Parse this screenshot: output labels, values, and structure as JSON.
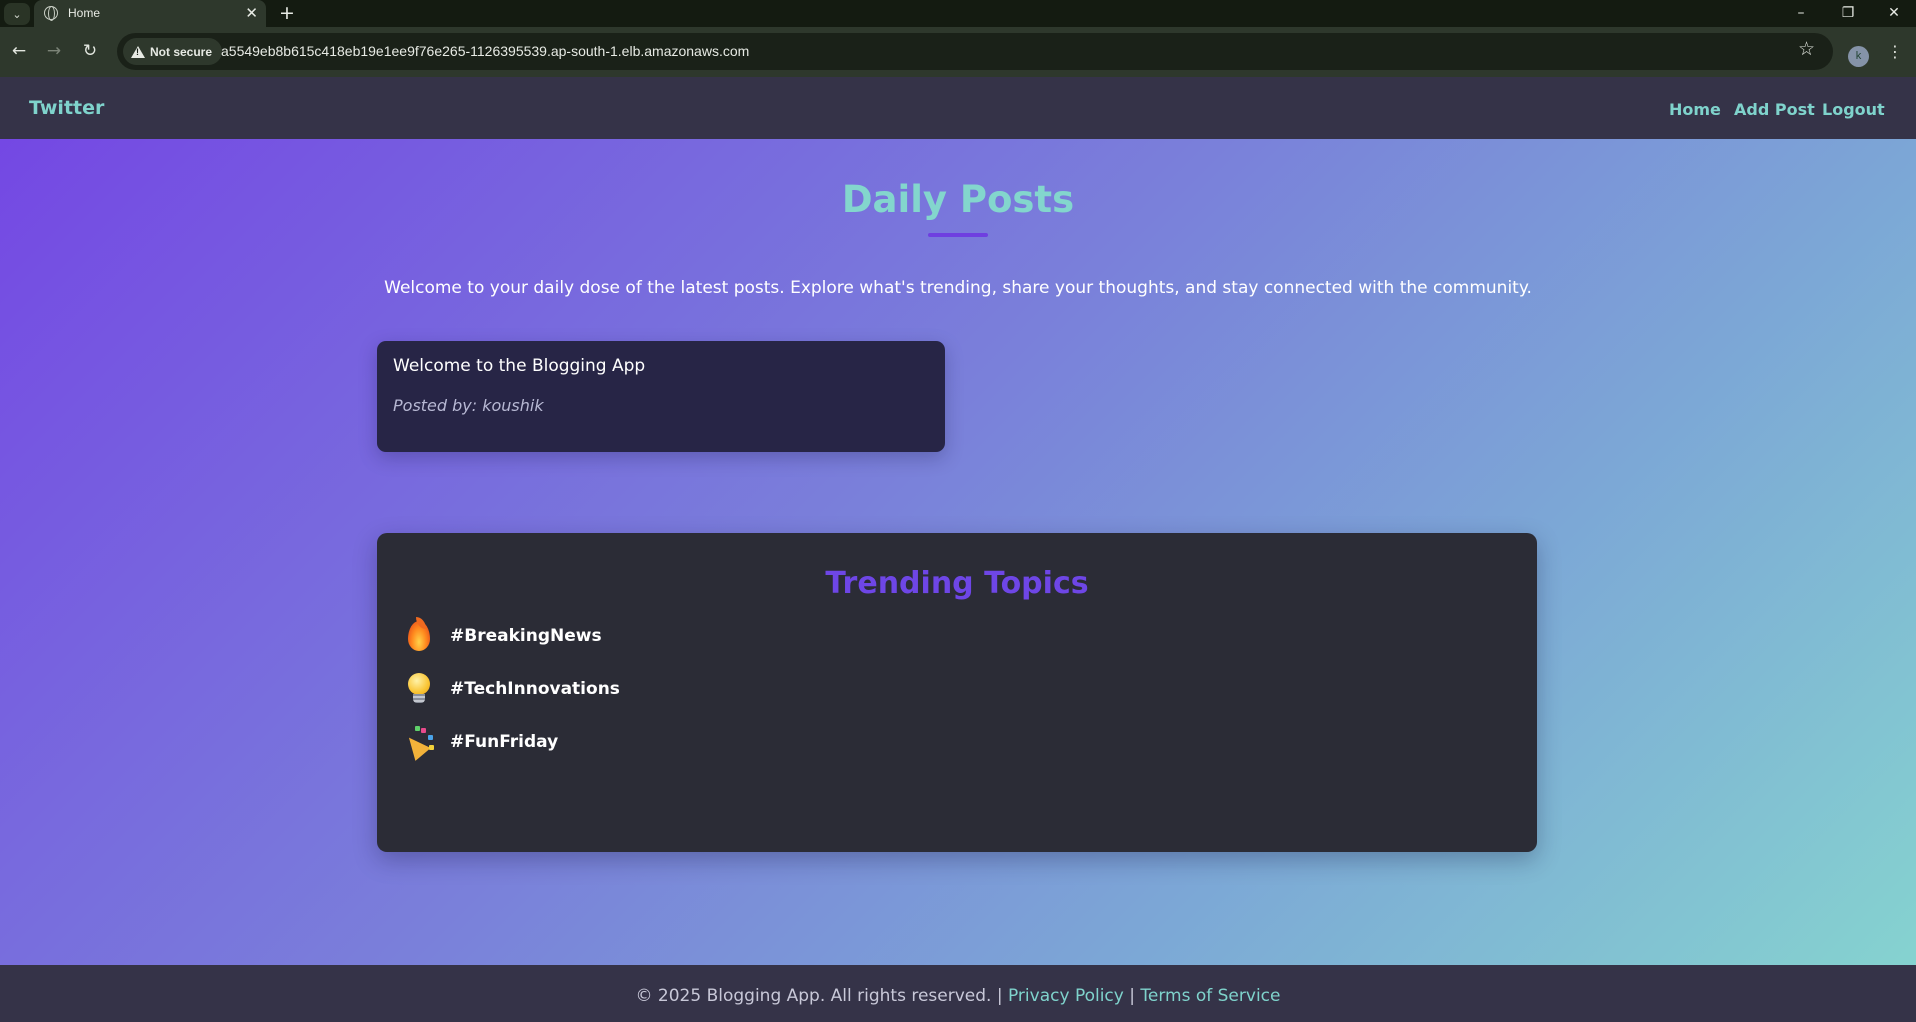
{
  "browser": {
    "tab_title": "Home",
    "new_tab_symbol": "+",
    "security_label": "Not secure",
    "url": "a5549eb8b615c418eb19e1ee9f76e265-1126395539.ap-south-1.elb.amazonaws.com",
    "profile_initial": "k"
  },
  "header": {
    "brand": "Twitter",
    "nav": [
      {
        "label": "Home"
      },
      {
        "label": "Add Post"
      },
      {
        "label": "Logout"
      }
    ]
  },
  "main": {
    "title": "Daily Posts",
    "intro": "Welcome to your daily dose of the latest posts. Explore what's trending, share your thoughts, and stay connected with the community.",
    "posts": [
      {
        "title": "Welcome to the Blogging App",
        "author_line": "Posted by: koushik"
      }
    ]
  },
  "trending": {
    "title": "Trending Topics",
    "topics": [
      {
        "icon": "fire-icon",
        "label": "#BreakingNews"
      },
      {
        "icon": "lightbulb-icon",
        "label": "#TechInnovations"
      },
      {
        "icon": "party-popper-icon",
        "label": "#FunFriday"
      }
    ]
  },
  "footer": {
    "copyright": "© 2025 Blogging App. All rights reserved.",
    "separator": "|",
    "privacy_label": "Privacy Policy",
    "terms_label": "Terms of Service"
  },
  "colors": {
    "accent_teal": "#7fd3cc",
    "accent_purple": "#6e46e6",
    "header_bg": "#353348",
    "card_bg": "#272546",
    "trending_bg": "#2b2c36"
  }
}
